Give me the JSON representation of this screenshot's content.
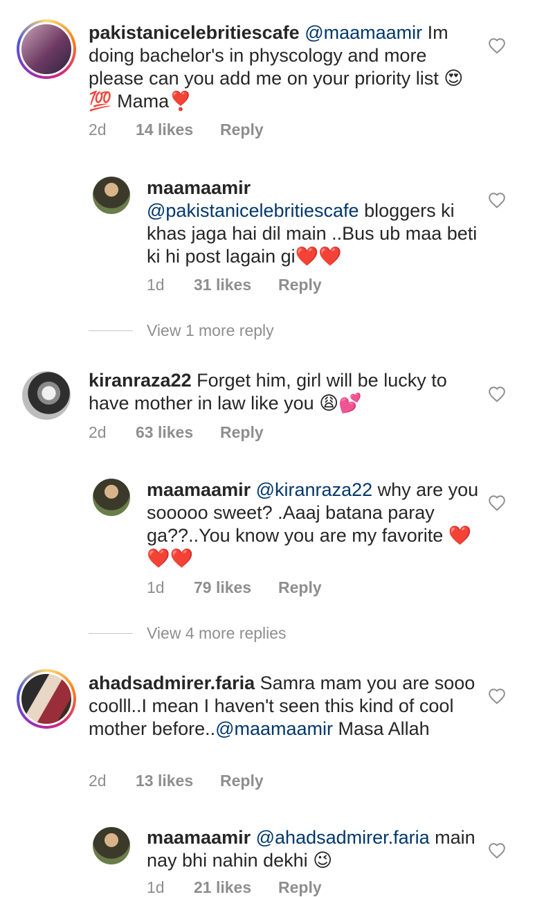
{
  "comments": [
    {
      "username": "pakistanicelebritiescafe",
      "mention": "@maamaamir",
      "text_before": "",
      "text_after": " Im doing bachelor's in physcology and more please can you add me on your priority list 😍 💯 Mama❣️",
      "time": "2d",
      "likes": "14 likes",
      "reply": "Reply",
      "avatar_icon": "avatar-icon"
    },
    {
      "username": "maamaamir",
      "mention": "@pakistanicelebritiescafe",
      "text_before": "",
      "text_after": " bloggers ki khas jaga hai dil main ..Bus ub maa beti ki hi post lagain gi❤️❤️",
      "time": "1d",
      "likes": "31 likes",
      "reply": "Reply",
      "avatar_icon": "avatar-icon"
    },
    {
      "username": "kiranraza22",
      "mention": "",
      "text_before": " Forget him, girl will be lucky to have mother in law like you 😩💕",
      "text_after": "",
      "time": "2d",
      "likes": "63 likes",
      "reply": "Reply",
      "avatar_icon": "avatar-icon"
    },
    {
      "username": "maamaamir",
      "mention": "@kiranraza22",
      "text_before": "",
      "text_after": " why are you sooooo sweet? .Aaaj batana paray ga??..You know you are my favorite ❤️❤️❤️",
      "time": "1d",
      "likes": "79 likes",
      "reply": "Reply",
      "avatar_icon": "avatar-icon"
    },
    {
      "username": "ahadsadmirer.faria",
      "mention": "@maamaamir",
      "text_before": " Samra mam you are sooo coolll..I mean I haven't seen this kind of cool mother before..",
      "text_after": " Masa Allah",
      "time": "2d",
      "likes": "13 likes",
      "reply": "Reply",
      "avatar_icon": "avatar-icon"
    },
    {
      "username": "maamaamir",
      "mention": "@ahadsadmirer.faria",
      "text_before": "",
      "text_after": " main nay bhi nahin dekhi 😉",
      "time": "1d",
      "likes": "21 likes",
      "reply": "Reply",
      "avatar_icon": "avatar-icon"
    }
  ],
  "view_more": [
    {
      "label": "View 1 more reply"
    },
    {
      "label": "View 4 more replies"
    }
  ],
  "colors": {
    "text": "#262626",
    "muted": "#8e8e8e",
    "mention": "#00376b",
    "heart_outline": "#8e8e8e"
  }
}
